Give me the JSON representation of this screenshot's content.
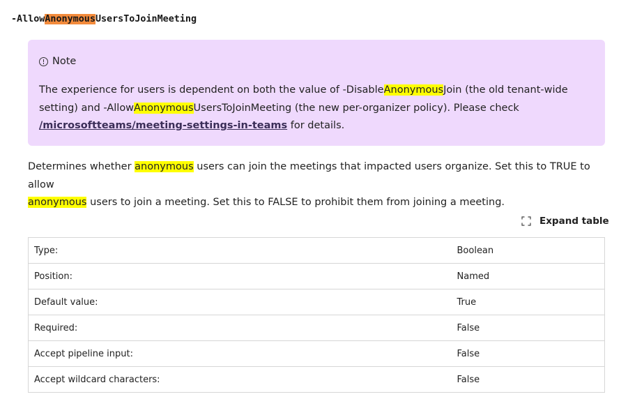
{
  "parameter": {
    "prefix": "-Allow",
    "highlight": "Anonymous",
    "suffix": "UsersToJoinMeeting"
  },
  "note": {
    "title": "Note",
    "icon": "info-icon",
    "body": {
      "p1": "The experience for users is dependent on both the value of -Disable",
      "h1": "Anonymous",
      "p2": "Join (the old tenant-wide setting) and -Allow",
      "h2": "Anonymous",
      "p3": "UsersToJoinMeeting (the new per-organizer policy). Please check",
      "link": "/microsoftteams/meeting-settings-in-teams",
      "p4": " for details."
    }
  },
  "description": {
    "p1": "Determines whether ",
    "h1": "anonymous",
    "p2": " users can join the meetings that impacted users organize. Set this to TRUE to allow",
    "h2": "anonymous",
    "p3": " users to join a meeting. Set this to FALSE to prohibit them from joining a meeting."
  },
  "expand_table": {
    "label": "Expand table",
    "icon": "expand-icon"
  },
  "table": {
    "rows": [
      {
        "key": "Type:",
        "value": "Boolean"
      },
      {
        "key": "Position:",
        "value": "Named"
      },
      {
        "key": "Default value:",
        "value": "True"
      },
      {
        "key": "Required:",
        "value": "False"
      },
      {
        "key": "Accept pipeline input:",
        "value": "False"
      },
      {
        "key": "Accept wildcard characters:",
        "value": "False"
      }
    ]
  },
  "colors": {
    "note_background": "#efd9fd",
    "highlight_orange": "#f38b3c",
    "highlight_yellow": "#ffff00"
  }
}
